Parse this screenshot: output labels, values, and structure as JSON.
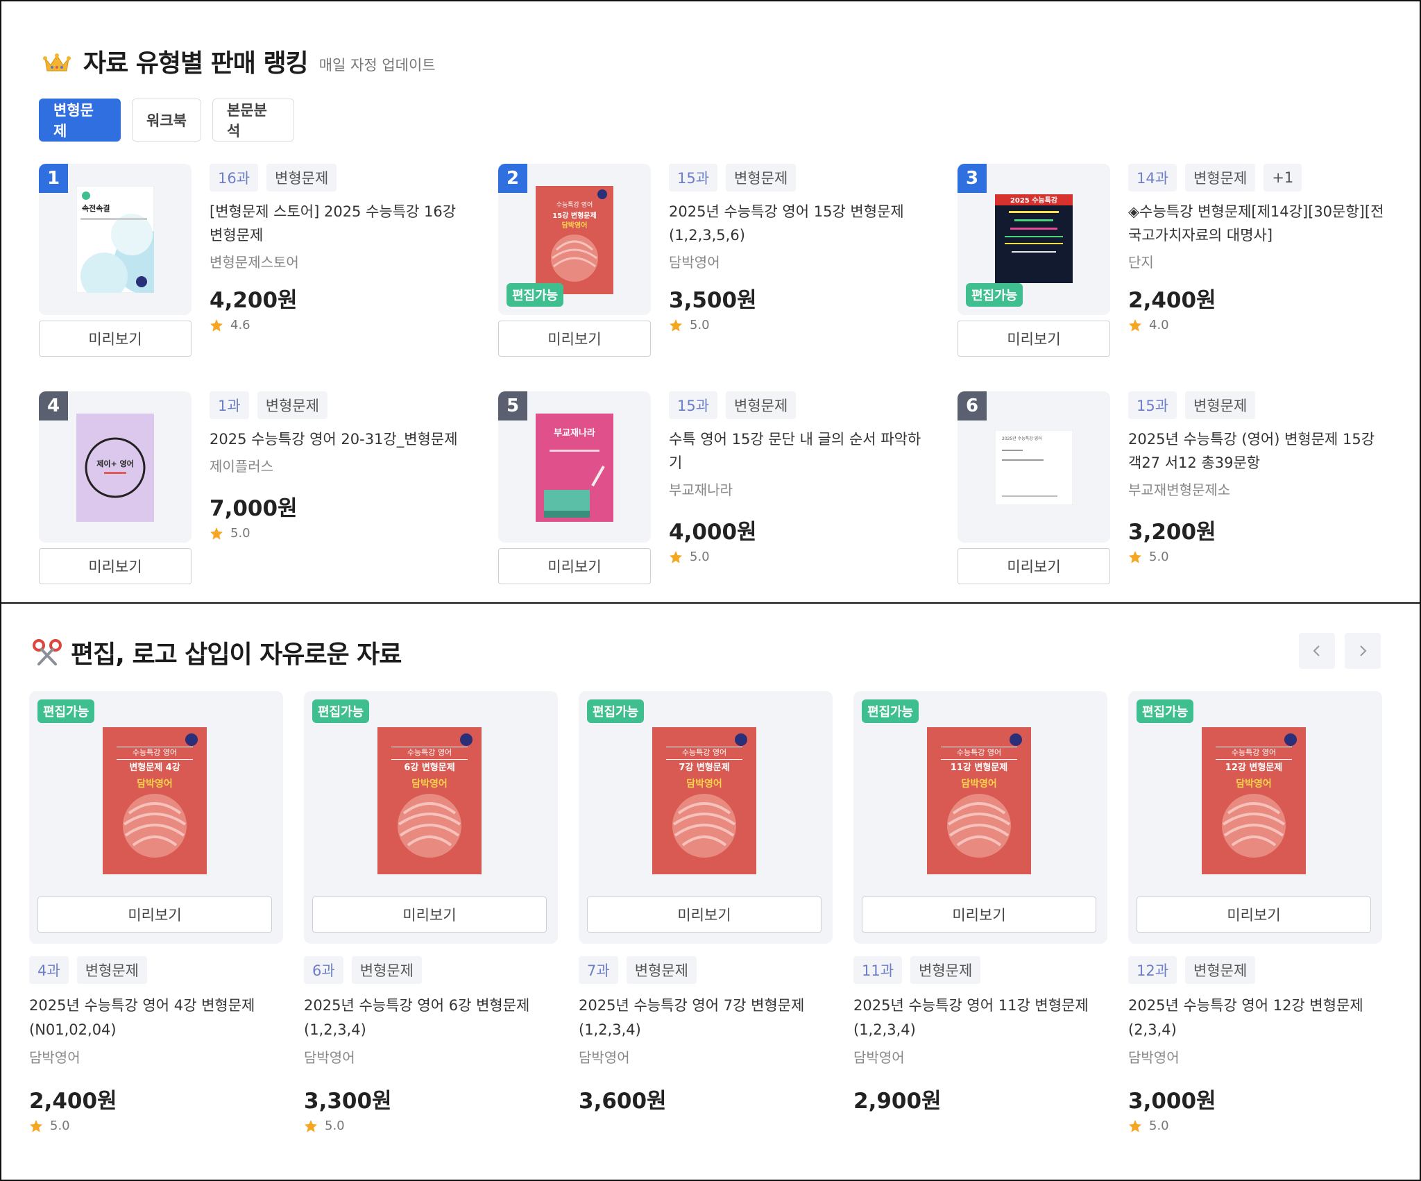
{
  "ranking": {
    "title": "자료 유형별 판매 랭킹",
    "subtitle": "매일 자정 업데이트",
    "tabs": [
      {
        "label": "변형문제",
        "active": true
      },
      {
        "label": "워크북",
        "active": false
      },
      {
        "label": "본문분석",
        "active": false
      }
    ],
    "items": [
      {
        "rank": "1",
        "chips": [
          "16과",
          "변형문제"
        ],
        "title": "[변형문제 스토어] 2025 수능특강 16강 변형문제",
        "seller": "변형문제스토어",
        "price": "4,200원",
        "rating": "4.6",
        "editable": false,
        "cover_title": "속전속결"
      },
      {
        "rank": "2",
        "chips": [
          "15과",
          "변형문제"
        ],
        "title": "2025년 수능특강 영어 15강 변형문제 (1,2,3,5,6)",
        "seller": "담박영어",
        "price": "3,500원",
        "rating": "5.0",
        "editable": true,
        "cover_title": "15강 변형문제"
      },
      {
        "rank": "3",
        "chips": [
          "14과",
          "변형문제",
          "+1"
        ],
        "title": "◈수능특강 변형문제[제14강][30문항][전국고가치자료의 대명사]",
        "seller": "단지",
        "price": "2,400원",
        "rating": "4.0",
        "editable": true,
        "cover_title": "2025 수능특강"
      },
      {
        "rank": "4",
        "chips": [
          "1과",
          "변형문제"
        ],
        "title": "2025 수능특강 영어 20-31강_변형문제",
        "seller": "제이플러스",
        "price": "7,000원",
        "rating": "5.0",
        "editable": false,
        "cover_title": "제이+ 영어"
      },
      {
        "rank": "5",
        "chips": [
          "15과",
          "변형문제"
        ],
        "title": "수특 영어 15강 문단 내 글의 순서 파악하기",
        "seller": "부교재나라",
        "price": "4,000원",
        "rating": "5.0",
        "editable": false,
        "cover_title": "부교재나라"
      },
      {
        "rank": "6",
        "chips": [
          "15과",
          "변형문제"
        ],
        "title": "2025년 수능특강 (영어) 변형문제 15강 객27 서12 총39문항",
        "seller": "부교재변형문제소",
        "price": "3,200원",
        "rating": "5.0",
        "editable": false,
        "cover_title": "2025년 수능특강 영어"
      }
    ],
    "preview_label": "미리보기",
    "edit_badge": "편집가능"
  },
  "editable": {
    "title": "편집, 로고 삽입이 자유로운 자료",
    "items": [
      {
        "chips": [
          "4과",
          "변형문제"
        ],
        "title": "2025년 수능특강 영어 4강 변형문제 (N01,02,04)",
        "seller": "담박영어",
        "price": "2,400원",
        "rating": "5.0",
        "cover_title": "변형문제 4강"
      },
      {
        "chips": [
          "6과",
          "변형문제"
        ],
        "title": "2025년 수능특강 영어 6강 변형문제 (1,2,3,4)",
        "seller": "담박영어",
        "price": "3,300원",
        "rating": "5.0",
        "cover_title": "6강 변형문제"
      },
      {
        "chips": [
          "7과",
          "변형문제"
        ],
        "title": "2025년 수능특강 영어 7강 변형문제 (1,2,3,4)",
        "seller": "담박영어",
        "price": "3,600원",
        "rating": "",
        "cover_title": "7강 변형문제"
      },
      {
        "chips": [
          "11과",
          "변형문제"
        ],
        "title": "2025년 수능특강 영어 11강 변형문제 (1,2,3,4)",
        "seller": "담박영어",
        "price": "2,900원",
        "rating": "",
        "cover_title": "11강 변형문제"
      },
      {
        "chips": [
          "12과",
          "변형문제"
        ],
        "title": "2025년 수능특강 영어 12강 변형문제 (2,3,4)",
        "seller": "담박영어",
        "price": "3,000원",
        "rating": "5.0",
        "cover_title": "12강 변형문제"
      }
    ],
    "cover_top": "수능특강 영어",
    "cover_brand": "담박영어"
  },
  "colors": {
    "accent": "#2f6fe0",
    "edit_badge": "#3fbf8f",
    "star": "#f5a623",
    "book_red": "#d85a52"
  },
  "icons": [
    "crown-icon",
    "scissors-icon",
    "star-icon",
    "chevron-left-icon",
    "chevron-right-icon"
  ]
}
